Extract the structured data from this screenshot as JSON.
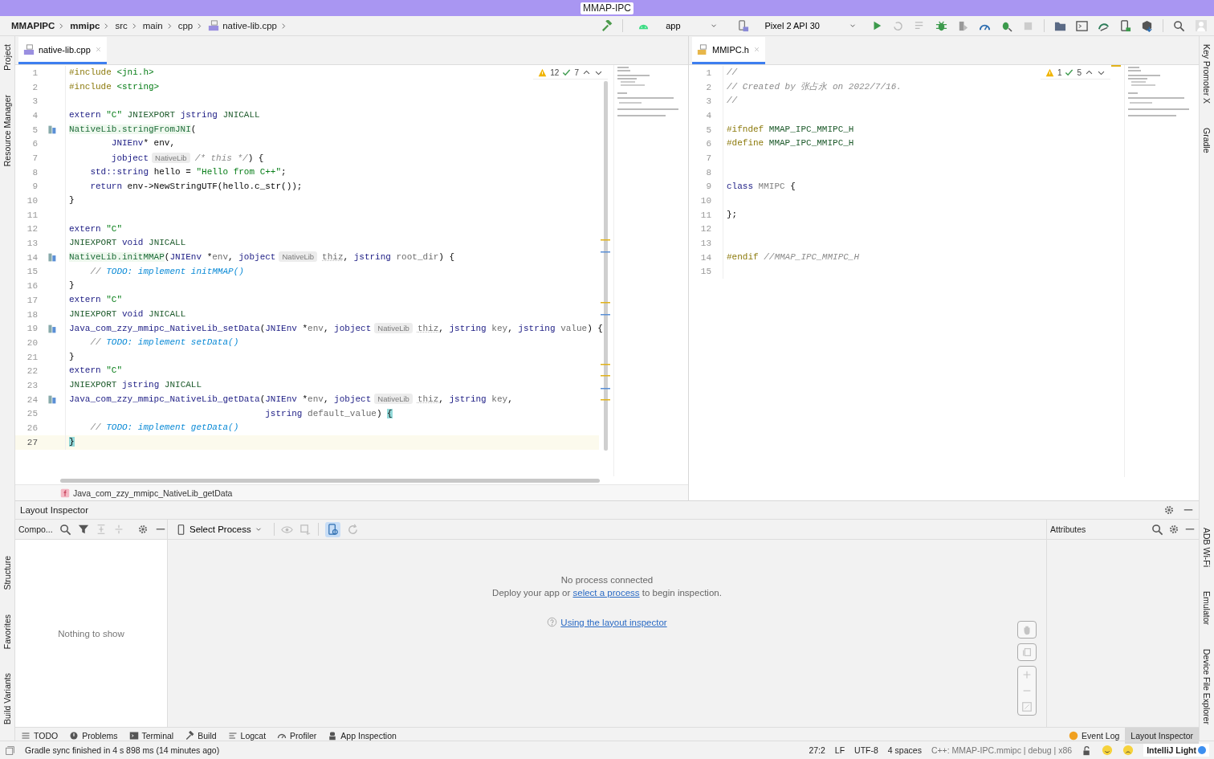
{
  "window": {
    "title": "MMAP-IPC"
  },
  "breadcrumb": [
    {
      "label": "MMAPIPC",
      "kind": "project"
    },
    {
      "label": "mmipc",
      "kind": "module"
    },
    {
      "label": "src",
      "kind": "dir"
    },
    {
      "label": "main",
      "kind": "dir"
    },
    {
      "label": "cpp",
      "kind": "dir"
    },
    {
      "label": "native-lib.cpp",
      "kind": "file"
    }
  ],
  "toolbar": {
    "config": "app",
    "device": "Pixel 2 API 30"
  },
  "left_strip": {
    "top": [
      "Project",
      "Resource Manager"
    ],
    "bottom": [
      "Structure",
      "Favorites",
      "Build Variants"
    ]
  },
  "right_strip": {
    "top": [
      "Key Promoter X",
      "Gradle"
    ],
    "bottom": [
      "ADB Wi-Fi",
      "Emulator",
      "Device File Explorer"
    ]
  },
  "editors": [
    {
      "tab": {
        "label": "native-lib.cpp",
        "kind": "cpp",
        "selected": true
      },
      "problems": {
        "warnings": "12",
        "checks": "7"
      },
      "footer": "Java_com_zzy_mmipc_NativeLib_getData",
      "lines": [
        {
          "n": "1",
          "current": false,
          "code": [
            {
              "kind": "pre",
              "text": "#include"
            },
            {
              "kind": "str",
              "text": " <jni.h>"
            }
          ]
        },
        {
          "n": "2",
          "current": false,
          "code": [
            {
              "kind": "pre",
              "text": "#include"
            },
            {
              "kind": "str",
              "text": " <string>"
            }
          ]
        },
        {
          "n": "3",
          "current": false
        },
        {
          "n": "4",
          "current": false,
          "code": [
            {
              "kind": "kw",
              "text": "extern"
            },
            {
              "kind": "str",
              "text": " \"C\""
            },
            {
              "kind": "macro",
              "text": " JNIEXPORT"
            },
            {
              "kind": "kw",
              "text": " jstring"
            },
            {
              "kind": "macro",
              "text": " JNICALL"
            }
          ]
        },
        {
          "n": "5",
          "current": false,
          "navigable": true,
          "code": [
            {
              "kind": "fn",
              "text": "NativeLib.stringFromJNI"
            },
            {
              "kind": "plain",
              "text": "("
            }
          ]
        },
        {
          "n": "6",
          "current": false,
          "code": [
            {
              "kind": "kw",
              "text": "        JNIEnv"
            },
            {
              "kind": "plain",
              "text": "* env,"
            }
          ]
        },
        {
          "n": "7",
          "current": false,
          "code": [
            {
              "kind": "kw",
              "text": "        jobject"
            },
            {
              "kind": "hint",
              "text": "NativeLib"
            },
            {
              "kind": "comment",
              "text": "/* this */"
            },
            {
              "kind": "plain",
              "text": ") {"
            }
          ]
        },
        {
          "n": "8",
          "current": false,
          "code": [
            {
              "kind": "kw",
              "text": "    std::string"
            },
            {
              "kind": "plain",
              "text": " hello = "
            },
            {
              "kind": "str",
              "text": "\"Hello from C++\""
            },
            {
              "kind": "plain",
              "text": ";"
            }
          ]
        },
        {
          "n": "9",
          "current": false,
          "code": [
            {
              "kind": "kw",
              "text": "    return"
            },
            {
              "kind": "plain",
              "text": " env->NewStringUTF(hello.c_str());"
            }
          ]
        },
        {
          "n": "10",
          "current": false,
          "code": [
            {
              "kind": "plain",
              "text": "}"
            }
          ]
        },
        {
          "n": "11",
          "current": false
        },
        {
          "n": "12",
          "current": false,
          "code": [
            {
              "kind": "kw",
              "text": "extern"
            },
            {
              "kind": "str",
              "text": " \"C\""
            }
          ]
        },
        {
          "n": "13",
          "current": false,
          "code": [
            {
              "kind": "macro",
              "text": "JNIEXPORT"
            },
            {
              "kind": "kw",
              "text": " void"
            },
            {
              "kind": "macro",
              "text": " JNICALL"
            }
          ]
        },
        {
          "n": "14",
          "current": false,
          "navigable": true,
          "code": [
            {
              "kind": "fn",
              "text": "NativeLib.initMMAP"
            },
            {
              "kind": "plain",
              "text": "("
            },
            {
              "kind": "kw",
              "text": "JNIEnv"
            },
            {
              "kind": "plain",
              "text": " *"
            },
            {
              "kind": "param",
              "text": "env"
            },
            {
              "kind": "plain",
              "text": ", "
            },
            {
              "kind": "kw",
              "text": "jobject"
            },
            {
              "kind": "hint",
              "text": "NativeLib"
            },
            {
              "kind": "unused",
              "text": "thiz"
            },
            {
              "kind": "plain",
              "text": ", "
            },
            {
              "kind": "kw",
              "text": "jstring"
            },
            {
              "kind": "param",
              "text": " root_dir"
            },
            {
              "kind": "plain",
              "text": ") {"
            }
          ]
        },
        {
          "n": "15",
          "current": false,
          "code": [
            {
              "kind": "comment",
              "text": "    // "
            },
            {
              "kind": "todo",
              "text": "TODO: implement initMMAP()"
            }
          ]
        },
        {
          "n": "16",
          "current": false,
          "code": [
            {
              "kind": "plain",
              "text": "}"
            }
          ]
        },
        {
          "n": "17",
          "current": false,
          "code": [
            {
              "kind": "kw",
              "text": "extern"
            },
            {
              "kind": "str",
              "text": " \"C\""
            }
          ]
        },
        {
          "n": "18",
          "current": false,
          "code": [
            {
              "kind": "macro",
              "text": "JNIEXPORT"
            },
            {
              "kind": "kw",
              "text": " void"
            },
            {
              "kind": "macro",
              "text": " JNICALL"
            }
          ]
        },
        {
          "n": "19",
          "current": false,
          "navigable": true,
          "code": [
            {
              "kind": "decl",
              "text": "Java_com_zzy_mmipc_NativeLib_setData"
            },
            {
              "kind": "plain",
              "text": "("
            },
            {
              "kind": "kw",
              "text": "JNIEnv"
            },
            {
              "kind": "plain",
              "text": " *"
            },
            {
              "kind": "param",
              "text": "env"
            },
            {
              "kind": "plain",
              "text": ", "
            },
            {
              "kind": "kw",
              "text": "jobject"
            },
            {
              "kind": "hint",
              "text": "NativeLib"
            },
            {
              "kind": "unused",
              "text": "thiz"
            },
            {
              "kind": "plain",
              "text": ", "
            },
            {
              "kind": "kw",
              "text": "jstring"
            },
            {
              "kind": "param",
              "text": " key"
            },
            {
              "kind": "plain",
              "text": ", "
            },
            {
              "kind": "kw",
              "text": "jstring"
            },
            {
              "kind": "param",
              "text": " value"
            },
            {
              "kind": "plain",
              "text": ") {"
            }
          ]
        },
        {
          "n": "20",
          "current": false,
          "code": [
            {
              "kind": "comment",
              "text": "    // "
            },
            {
              "kind": "todo",
              "text": "TODO: implement setData()"
            }
          ]
        },
        {
          "n": "21",
          "current": false,
          "code": [
            {
              "kind": "plain",
              "text": "}"
            }
          ]
        },
        {
          "n": "22",
          "current": false,
          "code": [
            {
              "kind": "kw",
              "text": "extern"
            },
            {
              "kind": "str",
              "text": " \"C\""
            }
          ]
        },
        {
          "n": "23",
          "current": false,
          "code": [
            {
              "kind": "macro",
              "text": "JNIEXPORT"
            },
            {
              "kind": "kw",
              "text": " jstring"
            },
            {
              "kind": "macro",
              "text": " JNICALL"
            }
          ]
        },
        {
          "n": "24",
          "current": false,
          "navigable": true,
          "code": [
            {
              "kind": "decl",
              "text": "Java_com_zzy_mmipc_NativeLib_getData"
            },
            {
              "kind": "plain",
              "text": "("
            },
            {
              "kind": "kw",
              "text": "JNIEnv"
            },
            {
              "kind": "plain",
              "text": " *"
            },
            {
              "kind": "param",
              "text": "env"
            },
            {
              "kind": "plain",
              "text": ", "
            },
            {
              "kind": "kw",
              "text": "jobject"
            },
            {
              "kind": "hint",
              "text": "NativeLib"
            },
            {
              "kind": "unused",
              "text": "thiz"
            },
            {
              "kind": "plain",
              "text": ", "
            },
            {
              "kind": "kw",
              "text": "jstring"
            },
            {
              "kind": "param",
              "text": " key"
            },
            {
              "kind": "plain",
              "text": ","
            }
          ]
        },
        {
          "n": "25",
          "current": false,
          "code": [
            {
              "kind": "kw",
              "text": "                                     jstring"
            },
            {
              "kind": "param",
              "text": " default_value"
            },
            {
              "kind": "plain",
              "text": ") "
            },
            {
              "kind": "match",
              "text": "{"
            }
          ]
        },
        {
          "n": "26",
          "current": false,
          "code": [
            {
              "kind": "comment",
              "text": "    // "
            },
            {
              "kind": "todo",
              "text": "TODO: implement getData()"
            }
          ]
        },
        {
          "n": "27",
          "current": true,
          "code": [
            {
              "kind": "match",
              "text": "}"
            }
          ]
        }
      ]
    },
    {
      "tab": {
        "label": "MMIPC.h",
        "kind": "h",
        "selected": true
      },
      "problems": {
        "warnings": "1",
        "checks": "5"
      },
      "lines": [
        {
          "n": "1",
          "current": false,
          "code": [
            {
              "kind": "comment",
              "text": "//"
            }
          ]
        },
        {
          "n": "2",
          "current": false,
          "code": [
            {
              "kind": "comment",
              "text": "// Created by 张占永 on 2022/7/16."
            }
          ]
        },
        {
          "n": "3",
          "current": false,
          "code": [
            {
              "kind": "comment",
              "text": "//"
            }
          ]
        },
        {
          "n": "4",
          "current": false
        },
        {
          "n": "5",
          "current": false,
          "code": [
            {
              "kind": "pre",
              "text": "#ifndef"
            },
            {
              "kind": "macro",
              "text": " MMAP_IPC_MMIPC_H"
            }
          ]
        },
        {
          "n": "6",
          "current": false,
          "code": [
            {
              "kind": "pre",
              "text": "#define"
            },
            {
              "kind": "macro",
              "text": " MMAP_IPC_MMIPC_H"
            }
          ]
        },
        {
          "n": "7",
          "current": false
        },
        {
          "n": "8",
          "current": false
        },
        {
          "n": "9",
          "current": false,
          "code": [
            {
              "kind": "kw",
              "text": "class"
            },
            {
              "kind": "grey",
              "text": " MMIPC"
            },
            {
              "kind": "plain",
              "text": " {"
            }
          ]
        },
        {
          "n": "10",
          "current": false
        },
        {
          "n": "11",
          "current": false,
          "code": [
            {
              "kind": "plain",
              "text": "};"
            }
          ]
        },
        {
          "n": "12",
          "current": false
        },
        {
          "n": "13",
          "current": false
        },
        {
          "n": "14",
          "current": false,
          "code": [
            {
              "kind": "pre",
              "text": "#endif"
            },
            {
              "kind": "comment",
              "text": " //MMAP_IPC_MMIPC_H"
            }
          ]
        },
        {
          "n": "15",
          "current": false
        }
      ]
    }
  ],
  "inspector": {
    "title": "Layout Inspector",
    "tree_header": "Compo...",
    "tree_empty": "Nothing to show",
    "process_button": "Select Process",
    "message": "No process connected",
    "hint_before": "Deploy your app or ",
    "hint_link": "select a process",
    "hint_after": " to begin inspection.",
    "help_link": "Using the layout inspector",
    "attributes_header": "Attributes"
  },
  "bottom_tabs": {
    "left": [
      {
        "label": "TODO",
        "kind": "list"
      },
      {
        "label": "Problems",
        "kind": "problems"
      },
      {
        "label": "Terminal",
        "kind": "terminal"
      },
      {
        "label": "Build",
        "kind": "build"
      },
      {
        "label": "Logcat",
        "kind": "logcat"
      },
      {
        "label": "Profiler",
        "kind": "profiler"
      },
      {
        "label": "App Inspection",
        "kind": "inspection"
      }
    ],
    "right": [
      {
        "label": "Event Log",
        "selected": false
      },
      {
        "label": "Layout Inspector",
        "selected": true
      }
    ]
  },
  "status_bar": {
    "message": "Gradle sync finished in 4 s 898 ms (14 minutes ago)",
    "items": [
      "27:2",
      "LF",
      "UTF-8",
      "4 spaces"
    ],
    "context": "C++: MMAP-IPC.mmipc | debug | x86",
    "theme": "IntelliJ Light"
  }
}
